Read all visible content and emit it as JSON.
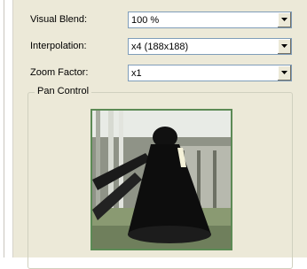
{
  "fields": {
    "visual_blend": {
      "label": "Visual Blend:",
      "value": "100 %",
      "icon": "chevron-down-icon"
    },
    "interpolation": {
      "label": "Interpolation:",
      "value": "x4 (188x188)",
      "icon": "chevron-down-icon"
    },
    "zoom_factor": {
      "label": "Zoom Factor:",
      "value": "x1",
      "icon": "chevron-down-icon"
    }
  },
  "pan_control": {
    "title": "Pan Control",
    "frame_color": "#5c8a55"
  }
}
